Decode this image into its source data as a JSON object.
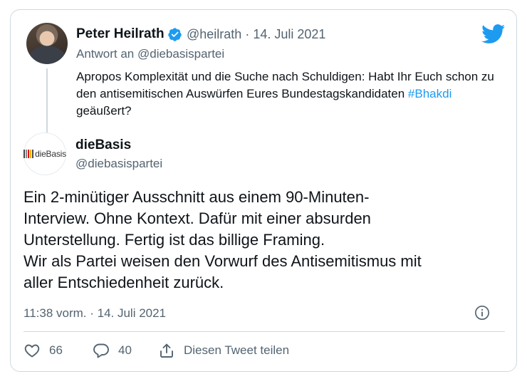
{
  "reply_tweet": {
    "author_name": "Peter Heilrath",
    "handle": "@heilrath",
    "separator": "·",
    "date": "14. Juli 2021",
    "reply_to": "Antwort an @diebasispartei",
    "text_part1": "Apropos Komplexität und die Suche nach Schuldigen: Habt Ihr Euch schon zu den antisemitischen Auswürfen Eures Bundestagskandidaten ",
    "hashtag": "#Bhakdi",
    "text_part2": " geäußert?"
  },
  "main_tweet": {
    "author_name": "dieBasis",
    "handle": "@diebasispartei",
    "avatar_logo_text": "dieBasis",
    "logo_colors": [
      "#444444",
      "#888888",
      "#e30613",
      "#f6b400",
      "#4a4a4a"
    ],
    "lines": [
      "Ein 2-minütiger Ausschnitt aus einem 90-Minuten-",
      "Interview. Ohne Kontext. Dafür mit einer absurden",
      "Unterstellung. Fertig ist das billige Framing.",
      "Wir als Partei weisen den Vorwurf des Antisemitismus mit",
      "aller Entschiedenheit zurück."
    ],
    "timestamp": "11:38 vorm. · 14. Juli 2021"
  },
  "actions": {
    "likes": "66",
    "replies": "40",
    "share_label": "Diesen Tweet teilen"
  },
  "icons": {
    "brand": "twitter-bird-icon",
    "verified": "verified-badge-icon",
    "info": "info-icon",
    "like": "heart-icon",
    "reply": "reply-bubble-icon",
    "share": "share-icon"
  },
  "colors": {
    "accent": "#1d9bf0",
    "muted_text": "#536471",
    "border": "#cfd9de"
  }
}
